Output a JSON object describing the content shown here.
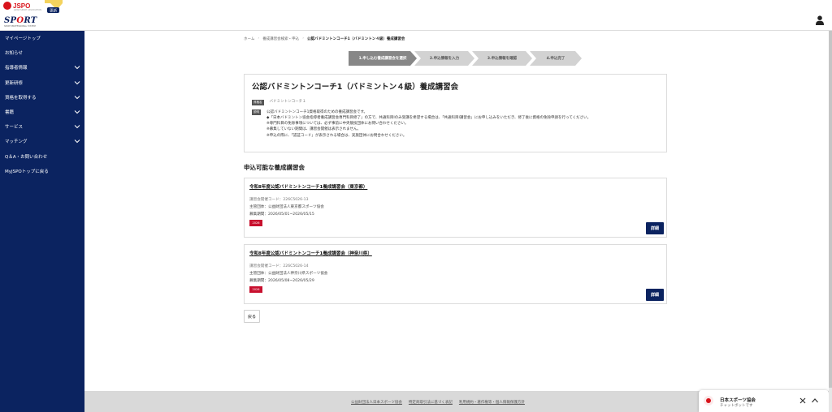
{
  "header": {
    "jspo_logo": "JSPO",
    "jspo_sub": "JAPAN SPORT ASSOCIATION",
    "badge": "更新",
    "sport_logo_prefix": "SP",
    "sport_logo_dot": "O",
    "sport_logo_suffix": "RT",
    "sport_sub": "SPORT PROFESSIONAL SYSTEM"
  },
  "sidebar": {
    "items": [
      {
        "label": "マイページトップ",
        "expandable": false
      },
      {
        "label": "お知らせ",
        "expandable": false
      },
      {
        "label": "指導者情報",
        "expandable": true
      },
      {
        "label": "更新研修",
        "expandable": true
      },
      {
        "label": "資格を取得する",
        "expandable": true
      },
      {
        "label": "書籍",
        "expandable": true
      },
      {
        "label": "サービス",
        "expandable": true
      },
      {
        "label": "マッチング",
        "expandable": true
      },
      {
        "label": "Q＆A・お問い合わせ",
        "expandable": false
      },
      {
        "label": "MyJSPOトップに戻る",
        "expandable": false
      }
    ]
  },
  "breadcrumb": {
    "home": "ホーム",
    "parent": "養成講習会検索・申込",
    "current": "公認バドミントンコーチ1（バドミントン４級）養成講習会"
  },
  "steps": [
    {
      "label": "1.申し込む養成講習会を選択",
      "active": true
    },
    {
      "label": "2.申込情報を入力",
      "active": false
    },
    {
      "label": "3.申込情報を確認",
      "active": false
    },
    {
      "label": "4.申込完了",
      "active": false
    }
  ],
  "intro": {
    "title": "公認バドミントンコーチ1（バドミントン４級）養成講習会",
    "qualification_tag": "資格名",
    "qualification": "バドミントンコーチ１",
    "description_tag": "説明",
    "description_lines": [
      "公認バドミントンコーチ1資格取得のための養成講習会です。",
      "◆「日本バドミントン協会指導者養成講習会専門科目修了」の方で、共通科目Ⅰのみ受講を希望する場合は、「共通科目Ⅰ講習会」にお申し込みをいただき、修了後に資格の免除申請を行ってください。",
      "※専門科目の免除事項については、必ず事前に中央競技団体にお問い合わせください。",
      "※募集していない期間は、講習会開催は表示されません。",
      "※申込の際に、「認証コード」が表示される場合は、実施団体にお問合わせください。"
    ]
  },
  "section_title": "申込可能な養成講習会",
  "courses": [
    {
      "title": "令和8年度公認バドミントンコーチ1養成講習会（東京都）",
      "code": "講習会開催コード：226C5026-13",
      "organizer": "主管団体：公益財団法人東京都スポーツ協会",
      "period": "募集期間：2026/05/01~2026/05/15",
      "year_badge": "2026",
      "detail_label": "詳細"
    },
    {
      "title": "令和8年度公認バドミントンコーチ1養成講習会（神奈川県）",
      "code": "講習会開催コード：226C5026-14",
      "organizer": "主管団体：公益財団法人神奈川県スポーツ協会",
      "period": "募集期間：2026/05/08~2026/05/29",
      "year_badge": "2026",
      "detail_label": "詳細"
    }
  ],
  "back_label": "戻る",
  "footer": {
    "links": [
      "公益財団法人日本スポーツ協会",
      "特定商取引法に基づく表記",
      "利用規約・著作権等・個人情報保護方針"
    ]
  },
  "chat": {
    "title": "日本スポーツ協会",
    "subtitle": "チャットボットです"
  },
  "colors": {
    "sidebar": "#0b2360",
    "brand_red": "#d8131b",
    "step_active": "#878787",
    "step_inactive": "#d2d2d2"
  }
}
